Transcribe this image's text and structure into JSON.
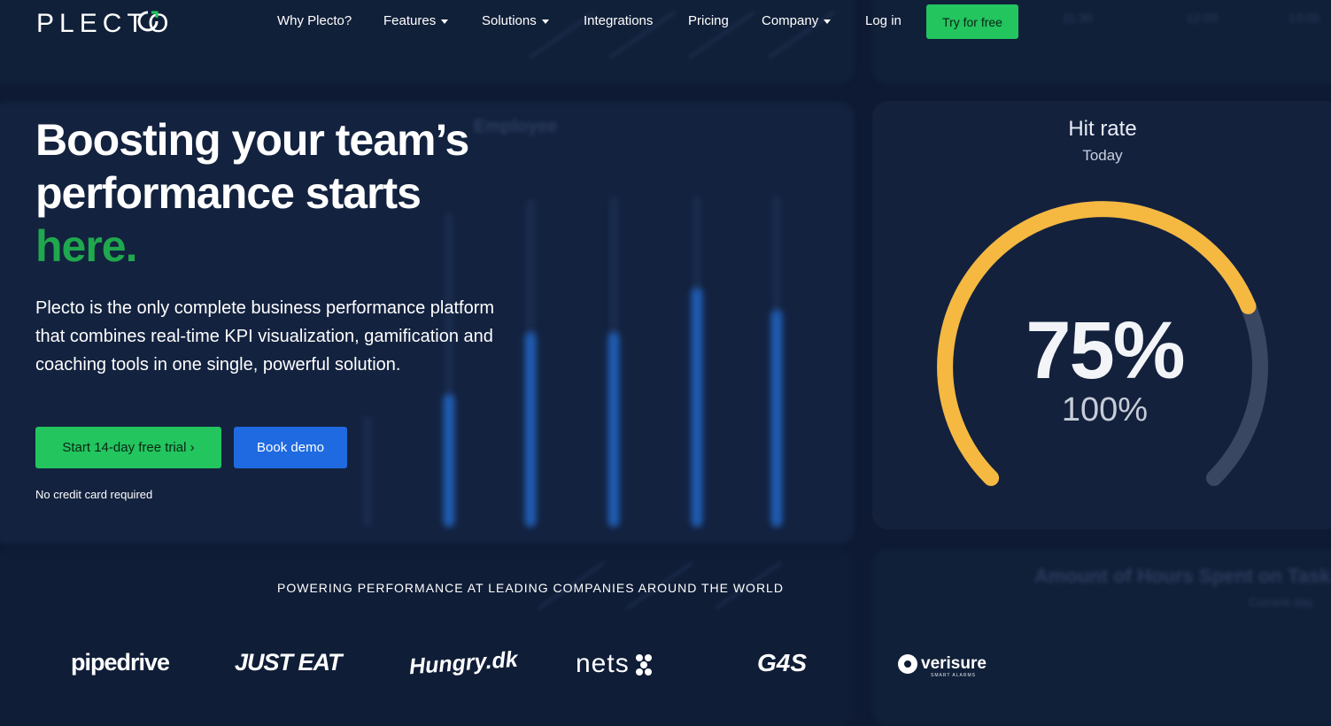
{
  "nav": {
    "logo": "PLECTO",
    "items": [
      {
        "label": "Why Plecto?",
        "dropdown": false
      },
      {
        "label": "Features",
        "dropdown": true
      },
      {
        "label": "Solutions",
        "dropdown": true
      },
      {
        "label": "Integrations",
        "dropdown": false
      },
      {
        "label": "Pricing",
        "dropdown": false
      },
      {
        "label": "Company",
        "dropdown": true
      },
      {
        "label": "Log in",
        "dropdown": false
      }
    ],
    "cta": "Try for free"
  },
  "hero": {
    "headline_line1": "Boosting your team’s",
    "headline_line2": "performance starts",
    "headline_accent": "here.",
    "description": "Plecto is the only complete business performance platform that combines real-time KPI visualization, gamification and coaching tools in one single, powerful solution.",
    "primary_button": "Start 14-day free trial ›",
    "secondary_button": "Book demo",
    "note": "No credit card required"
  },
  "gauge": {
    "title": "Hit rate",
    "subtitle": "Today",
    "value": "75%",
    "target": "100%",
    "fraction": 0.75
  },
  "logos": {
    "heading": "POWERING PERFORMANCE AT LEADING COMPANIES AROUND THE WORLD",
    "brands": [
      "pipedrive",
      "JUST EAT",
      "Hungry.dk",
      "nets",
      "G4S",
      "verisure"
    ],
    "verisure_tagline": "SMART ALARMS"
  },
  "colors": {
    "background": "#0e1a33",
    "green": "#22c55e",
    "accent_green_text": "#1fa84d",
    "blue": "#1f6ae0",
    "gauge_fill": "#f5b841",
    "gauge_track": "#3a4763"
  }
}
